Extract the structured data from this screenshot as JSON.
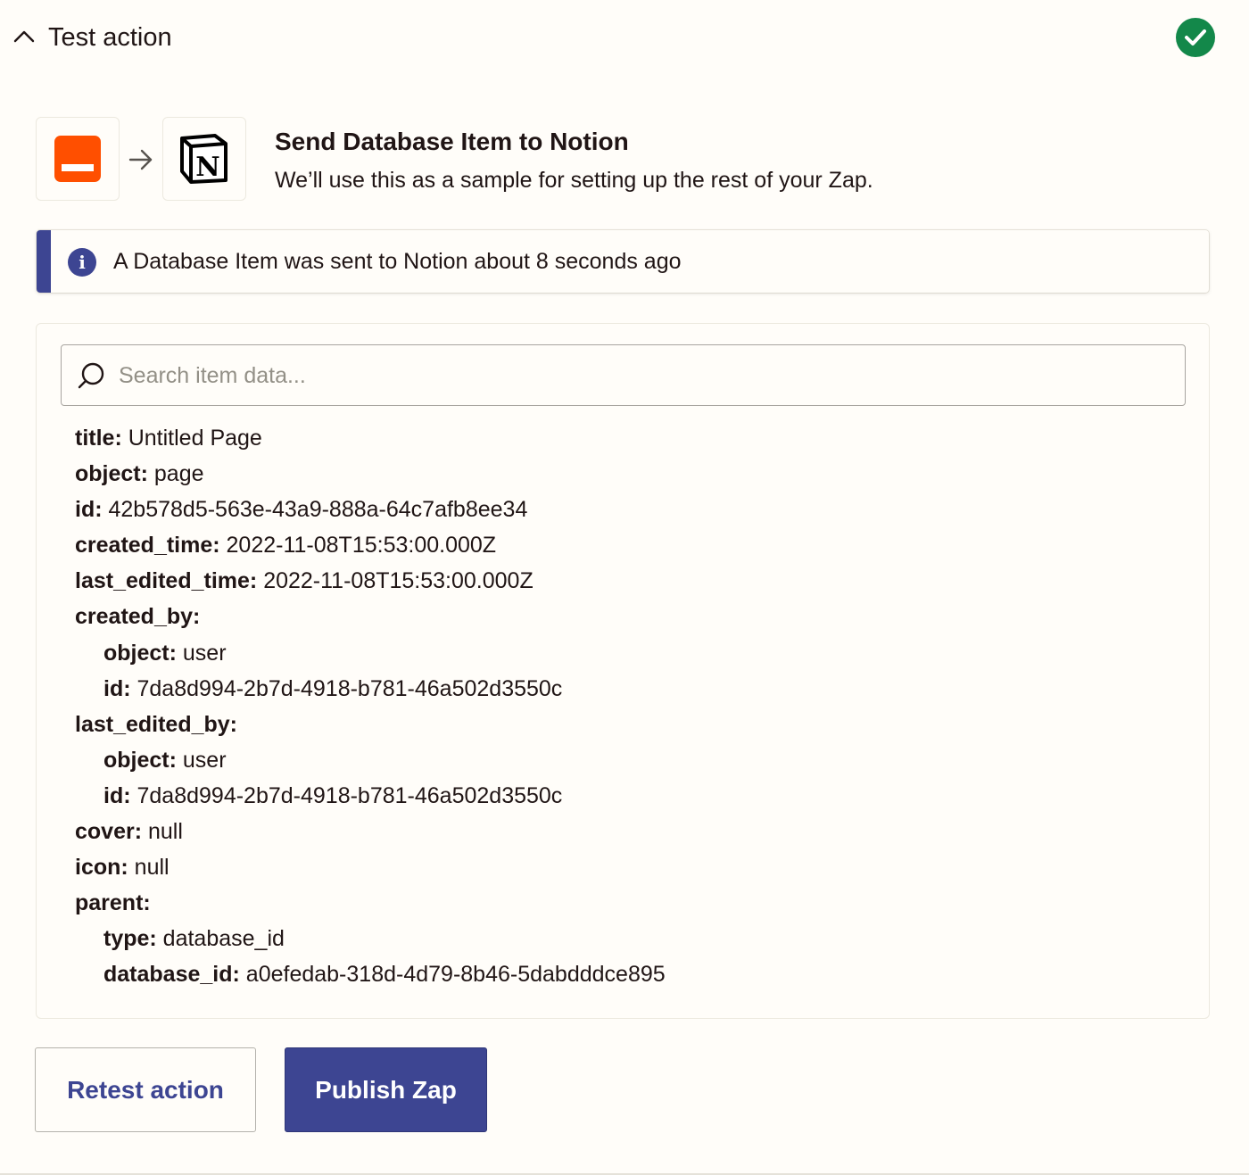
{
  "header": {
    "title": "Test action",
    "status_color": "#13884a",
    "collapse_icon": "chevron-up-icon",
    "status_icon": "check-circle-icon"
  },
  "action": {
    "title": "Send Database Item to Notion",
    "subtitle": "We’ll use this as a sample for setting up the rest of your Zap.",
    "trigger_app_icon": "trigger-app-icon",
    "trigger_app_color": "#ff4f00",
    "target_app_icon": "notion-logo-icon",
    "target_app_letter": "N"
  },
  "banner": {
    "icon_letter": "i",
    "text": "A Database Item was sent to Notion about 8 seconds ago",
    "accent_color": "#3d4592"
  },
  "search": {
    "placeholder": "Search item data...",
    "value": ""
  },
  "item_data": [
    {
      "key": "title:",
      "value": " Untitled Page",
      "nested": false
    },
    {
      "key": "object:",
      "value": " page",
      "nested": false
    },
    {
      "key": "id:",
      "value": " 42b578d5-563e-43a9-888a-64c7afb8ee34",
      "nested": false
    },
    {
      "key": "created_time:",
      "value": " 2022-11-08T15:53:00.000Z",
      "nested": false
    },
    {
      "key": "last_edited_time:",
      "value": " 2022-11-08T15:53:00.000Z",
      "nested": false
    },
    {
      "key": "created_by:",
      "value": "",
      "nested": false
    },
    {
      "key": "object:",
      "value": " user",
      "nested": true
    },
    {
      "key": "id:",
      "value": " 7da8d994-2b7d-4918-b781-46a502d3550c",
      "nested": true
    },
    {
      "key": "last_edited_by:",
      "value": "",
      "nested": false
    },
    {
      "key": "object:",
      "value": " user",
      "nested": true
    },
    {
      "key": "id:",
      "value": " 7da8d994-2b7d-4918-b781-46a502d3550c",
      "nested": true
    },
    {
      "key": "cover:",
      "value": " null",
      "nested": false
    },
    {
      "key": "icon:",
      "value": " null",
      "nested": false
    },
    {
      "key": "parent:",
      "value": "",
      "nested": false
    },
    {
      "key": "type:",
      "value": " database_id",
      "nested": true
    },
    {
      "key": "database_id:",
      "value": " a0efedab-318d-4d79-8b46-5dabdddce895",
      "nested": true
    }
  ],
  "buttons": {
    "retest_label": "Retest action",
    "publish_label": "Publish Zap",
    "primary_color": "#3d4592"
  }
}
